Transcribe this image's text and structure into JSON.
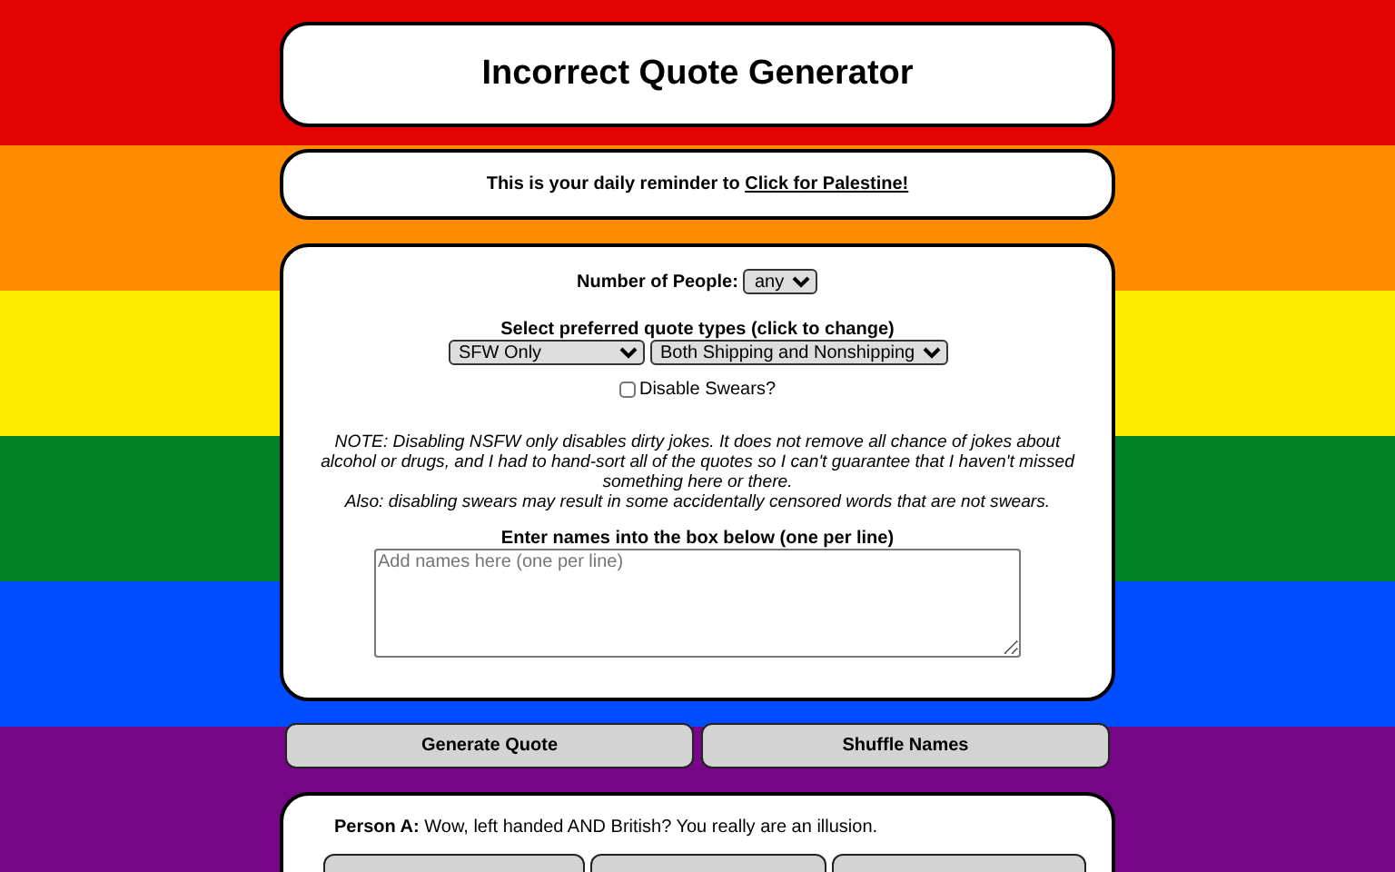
{
  "title": "Incorrect Quote Generator",
  "reminder": {
    "text": "This is your daily reminder to ",
    "link": "Click for Palestine!"
  },
  "number_of_people": {
    "label": "Number of People:",
    "value": "any"
  },
  "quote_types": {
    "label": "Select preferred quote types (click to change)",
    "selects": [
      "SFW Only",
      "Both Shipping and Nonshipping"
    ]
  },
  "disable_swears": {
    "label": "Disable Swears?",
    "checked": false
  },
  "notes": [
    "NOTE: Disabling NSFW only disables dirty jokes. It does not remove all chance of jokes about alcohol or drugs, and I had to hand-sort all of the quotes so I can't guarantee that I haven't missed something here or there.",
    "Also: disabling swears may result in some accidentally censored words that are not swears."
  ],
  "names": {
    "label": "Enter names into the box below (one per line)",
    "placeholder": "Add names here (one per line)"
  },
  "buttons": [
    "Generate Quote",
    "Shuffle Names"
  ],
  "quote": {
    "speaker": "Person A:",
    "text": " Wow, left handed AND British? You really are an illusion."
  },
  "quote_buttons": [
    {
      "kind": "button"
    },
    {
      "kind": "button"
    },
    {
      "kind": "button"
    }
  ]
}
